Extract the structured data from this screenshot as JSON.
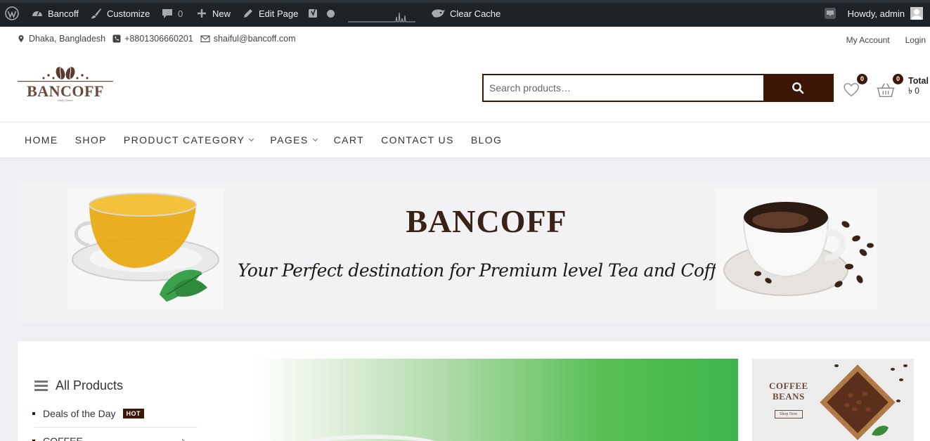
{
  "adminbar": {
    "site_name": "Bancoff",
    "customize": "Customize",
    "comments_count": "0",
    "new_label": "New",
    "edit_page": "Edit Page",
    "clear_cache": "Clear Cache",
    "howdy": "Howdy, admin"
  },
  "topbar": {
    "location": "Dhaka, Bangladesh",
    "phone": "+8801306660201",
    "email": "shaiful@bancoff.com",
    "my_account": "My Account",
    "login": "Login"
  },
  "logo": {
    "text": "BANCOFF",
    "tagline": "Daily Desire"
  },
  "search": {
    "placeholder": "Search products…"
  },
  "wishlist": {
    "count": "0"
  },
  "cart": {
    "count": "0",
    "total_label": "Total",
    "total_value": "৳ 0"
  },
  "nav": {
    "items": [
      {
        "label": "HOME",
        "has_dropdown": false
      },
      {
        "label": "SHOP",
        "has_dropdown": false
      },
      {
        "label": "PRODUCT CATEGORY",
        "has_dropdown": true
      },
      {
        "label": "PAGES",
        "has_dropdown": true
      },
      {
        "label": "CART",
        "has_dropdown": false
      },
      {
        "label": "CONTACT US",
        "has_dropdown": false
      },
      {
        "label": "BLOG",
        "has_dropdown": false
      }
    ]
  },
  "hero": {
    "title": "BANCOFF",
    "subtitle": "Your Perfect destination for Premium level Tea and Coffee"
  },
  "sidebar": {
    "heading": "All Products",
    "categories": [
      {
        "label": "Deals of the Day",
        "badge": "HOT"
      },
      {
        "label": "COFFEE"
      }
    ]
  },
  "promo": {
    "line1": "COFFEE",
    "line2": "BEANS",
    "button": "Shop Now"
  },
  "colors": {
    "brand": "#3c1606",
    "adminbar": "#1d2327",
    "slider_green": "#3cb54a"
  }
}
